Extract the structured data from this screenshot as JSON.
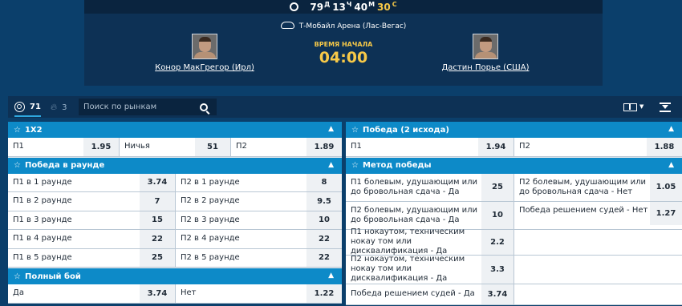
{
  "timer": {
    "days": "79",
    "days_unit": "Д",
    "hours": "13",
    "hours_unit": "Ч",
    "minutes": "40",
    "minutes_unit": "М",
    "seconds": "30",
    "seconds_unit": "С"
  },
  "event": {
    "arena": "Т-Мобайл Арена (Лас-Вегас)",
    "start_label": "ВРЕМЯ НАЧАЛА",
    "start_time": "04:00",
    "fighter1": "Конор МакГрегор (Ирл)",
    "fighter2": "Дастин Порье (США)"
  },
  "filters": {
    "all_count": "71",
    "hot_count": "3",
    "search_placeholder": "Поиск по рынкам"
  },
  "markets": {
    "x12": {
      "title": "1X2",
      "p1": "П1",
      "p1_odd": "1.95",
      "draw": "Ничья",
      "draw_odd": "51",
      "p2": "П2",
      "p2_odd": "1.89"
    },
    "round": {
      "title": "Победа в раунде",
      "rows": [
        {
          "a": "П1 в 1 раунде",
          "a_odd": "3.74",
          "b": "П2 в 1 раунде",
          "b_odd": "8"
        },
        {
          "a": "П1 в 2 раунде",
          "a_odd": "7",
          "b": "П2 в 2 раунде",
          "b_odd": "9.5"
        },
        {
          "a": "П1 в 3 раунде",
          "a_odd": "15",
          "b": "П2 в 3 раунде",
          "b_odd": "10"
        },
        {
          "a": "П1 в 4 раунде",
          "a_odd": "22",
          "b": "П2 в 4 раунде",
          "b_odd": "22"
        },
        {
          "a": "П1 в 5 раунде",
          "a_odd": "25",
          "b": "П2 в 5 раунде",
          "b_odd": "22"
        }
      ]
    },
    "full": {
      "title": "Полный бой",
      "yes": "Да",
      "yes_odd": "3.74",
      "no": "Нет",
      "no_odd": "1.22"
    },
    "win2": {
      "title": "Победа (2 исхода)",
      "p1": "П1",
      "p1_odd": "1.94",
      "p2": "П2",
      "p2_odd": "1.88"
    },
    "method": {
      "title": "Метод победы",
      "r1a": "П1 болевым, удушающим или до бровольная сдача - Да",
      "r1a_odd": "25",
      "r1b": "П2 болевым, удушающим или до бровольная сдача - Нет",
      "r1b_odd": "1.05",
      "r2a": "П2 болевым, удушающим или до бровольная сдача - Да",
      "r2a_odd": "10",
      "r2b": "Победа решением судей - Нет",
      "r2b_odd": "1.27",
      "r3a": "П1 нокаутом, техническим нокау том или дисквалификация - Да",
      "r3a_odd": "2.2",
      "r4a": "П2 нокаутом, техническим нокау том или дисквалификация - Да",
      "r4a_odd": "3.3",
      "r5a": "Победа решением судей - Да",
      "r5a_odd": "3.74"
    }
  }
}
